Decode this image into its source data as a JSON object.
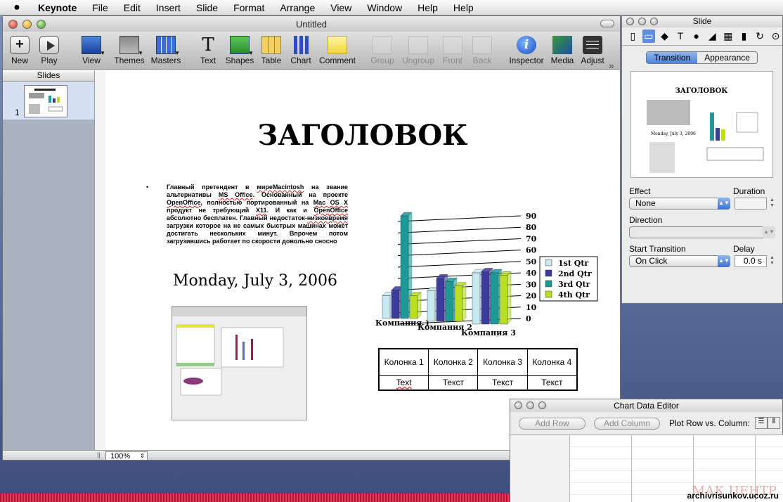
{
  "menubar": {
    "app": "Keynote",
    "items": [
      "File",
      "Edit",
      "Insert",
      "Slide",
      "Format",
      "Arrange",
      "View",
      "Window",
      "Help",
      "Help"
    ]
  },
  "window": {
    "title": "Untitled"
  },
  "toolbar": {
    "new": "New",
    "play": "Play",
    "view": "View",
    "themes": "Themes",
    "masters": "Masters",
    "text": "Text",
    "shapes": "Shapes",
    "table": "Table",
    "chart": "Chart",
    "comment": "Comment",
    "group": "Group",
    "ungroup": "Ungroup",
    "front": "Front",
    "back": "Back",
    "inspector": "Inspector",
    "media": "Media",
    "adjust": "Adjust",
    "more": "»"
  },
  "slides_pane": {
    "header": "Slides",
    "number": "1"
  },
  "slide": {
    "title": "ЗАГОЛОВОК",
    "bullet": "•",
    "body_parts": [
      "Главный претендент в ",
      "миреMacintosh",
      " на звание альтернативы ",
      "MS Office",
      ". Основанный на проекте ",
      "OpenOffice",
      ", полностью портированный на ",
      "Mac OS X",
      " продукт не требующий ",
      "X11",
      ". И как и ",
      "OpenOffice",
      " абсолютно бесплатен. Главный недостаток-",
      "низкоевремя",
      " загрузки которое на не самых быстрых машинах может достигать нескольких минут. Впрочем потом загрузившись работает по скорости довольно сносно"
    ],
    "date": "Monday, July 3, 2006",
    "table": {
      "header": [
        "Колонка 1",
        "Колонка 2",
        "Колонка 3",
        "Колонка 4"
      ],
      "row": [
        "Text",
        "Текст",
        "Текст",
        "Текст"
      ]
    }
  },
  "chart_data": {
    "type": "bar",
    "categories": [
      "Компания 1",
      "Компания 2",
      "Компания 3"
    ],
    "series": [
      {
        "name": "1st Qtr",
        "values": [
          20,
          27,
          45
        ]
      },
      {
        "name": "2nd Qtr",
        "values": [
          25,
          38,
          46
        ]
      },
      {
        "name": "3rd Qtr",
        "values": [
          90,
          35,
          45
        ]
      },
      {
        "name": "4th Qtr",
        "values": [
          20,
          31,
          43
        ]
      }
    ],
    "yticks": [
      "90",
      "80",
      "70",
      "60",
      "50",
      "40",
      "30",
      "20",
      "10",
      "0"
    ],
    "ylim": [
      0,
      90
    ],
    "colors": [
      "#c8e8f0",
      "#3c3ca0",
      "#1a9a9a",
      "#b8e020"
    ],
    "legend": "right"
  },
  "status": {
    "zoom": "100%"
  },
  "inspector": {
    "title": "Slide",
    "tab_transition": "Transition",
    "tab_appearance": "Appearance",
    "effect_label": "Effect",
    "effect_value": "None",
    "duration_label": "Duration",
    "direction_label": "Direction",
    "start_label": "Start Transition",
    "start_value": "On Click",
    "delay_label": "Delay",
    "delay_value": "0.0 s"
  },
  "chart_editor": {
    "title": "Chart Data Editor",
    "add_row": "Add Row",
    "add_column": "Add Column",
    "plot_label": "Plot Row vs. Column:"
  },
  "watermark": "МАК ЦЕНТР",
  "credit": "archivrisunkov.ucoz.ru"
}
